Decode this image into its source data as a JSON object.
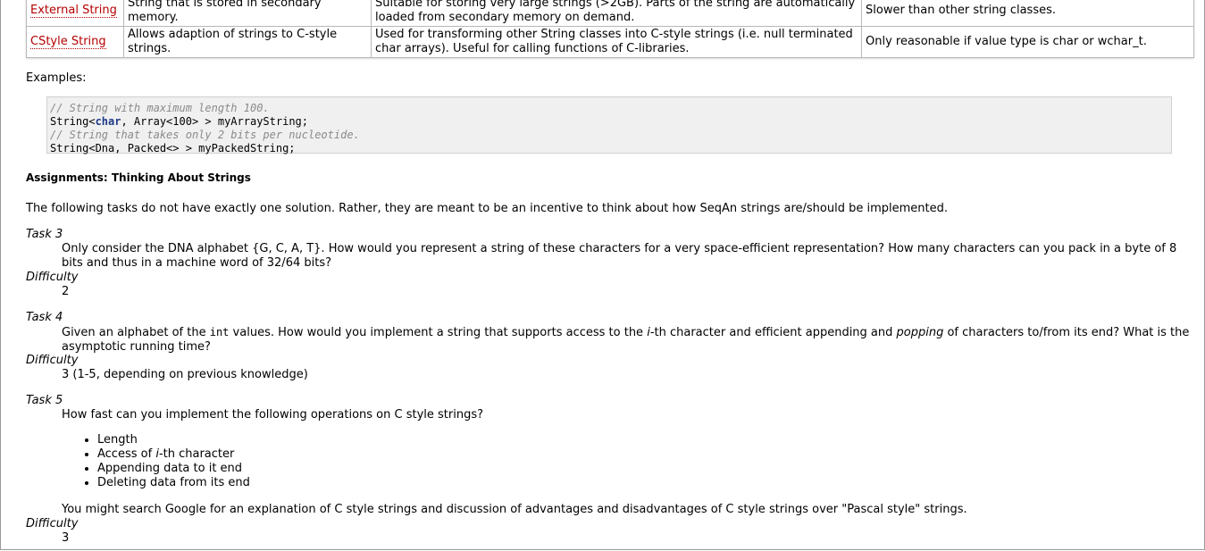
{
  "table": {
    "rows": [
      {
        "name": "External String",
        "c2": "String that is stored in secondary memory.",
        "c3": "Suitable for storing very large strings (>2GB). Parts of the string are automatically loaded from secondary memory on demand.",
        "c4": "Slower than other string classes."
      },
      {
        "name": "CStyle String",
        "c2": "Allows adaption of strings to C-style strings.",
        "c3": "Used for transforming other String classes into C-style strings (i.e. null terminated char arrays). Useful for calling functions of C-libraries.",
        "c4": "Only reasonable if value type is char or wchar_t."
      }
    ]
  },
  "examples_label": "Examples:",
  "code": {
    "line1_comment": "// String with maximum length 100.",
    "line2_pre": "String<",
    "line2_kw": "char",
    "line2_post": ", Array<100> > myArrayString;",
    "line3_comment": "// String that takes only 2 bits per nucleotide.",
    "line4": "String<Dna, Packed<> > myPackedString;"
  },
  "assignments_heading": "Assignments: Thinking About Strings",
  "intro": "The following tasks do not have exactly one solution. Rather, they are meant to be an incentive to think about how SeqAn strings are/should be implemented.",
  "task3": {
    "label": "Task 3",
    "text": "Only consider the DNA alphabet {G, C, A, T}. How would you represent a string of these characters for a very space-efficient representation? How many characters can you pack in a byte of 8 bits and thus in a machine word of 32/64 bits?",
    "difficulty_label": "Difficulty",
    "difficulty": "2"
  },
  "task4": {
    "label": "Task 4",
    "text_a": "Given an alphabet of the ",
    "text_code": "int",
    "text_b": " values. How would you implement a string that supports access to the ",
    "text_i": "i",
    "text_c": "-th character and efficient appending and ",
    "text_pop": "popping",
    "text_d": " of characters to/from its end? What is the asymptotic running time?",
    "difficulty_label": "Difficulty",
    "difficulty": "3 (1-5, depending on previous knowledge)"
  },
  "task5": {
    "label": "Task 5",
    "text": "How fast can you implement the following operations on C style strings?",
    "items": [
      {
        "pre": "Length",
        "i": "",
        "post": ""
      },
      {
        "pre": "Access of ",
        "i": "i",
        "post": "-th character"
      },
      {
        "pre": "Appending data to it end",
        "i": "",
        "post": ""
      },
      {
        "pre": "Deleting data from its end",
        "i": "",
        "post": ""
      }
    ],
    "note": "You might search Google for an explanation of C style strings and discussion of advantages and disadvantages of C style strings over \"Pascal style\" strings.",
    "difficulty_label": "Difficulty",
    "difficulty": "3"
  }
}
